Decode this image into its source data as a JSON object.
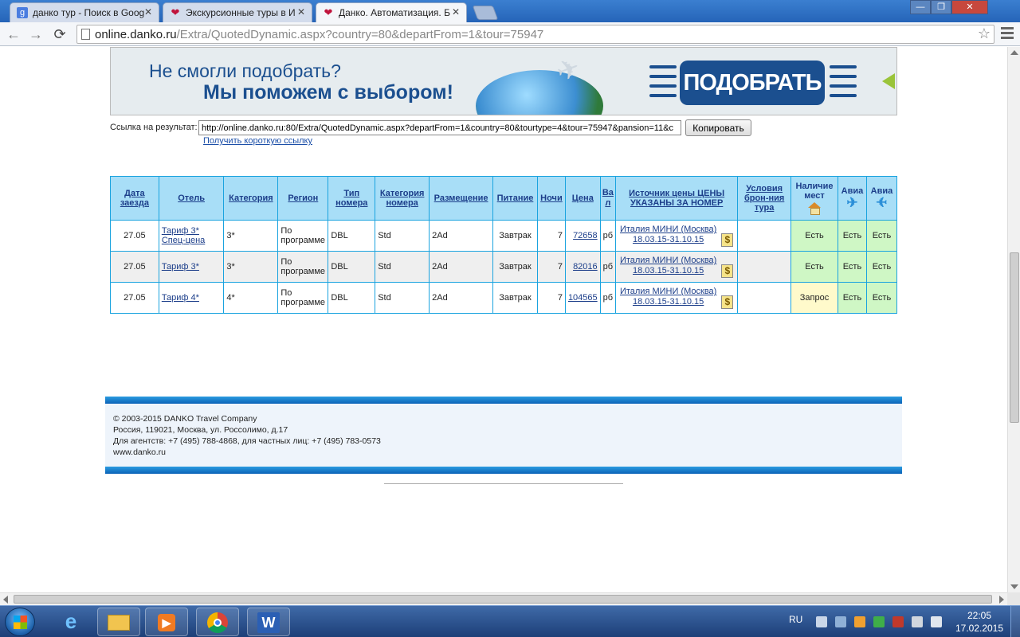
{
  "browser": {
    "tabs": [
      {
        "title": "данко тур - Поиск в Goog",
        "icon": "google-icon",
        "active": false
      },
      {
        "title": "Экскурсионные туры в И",
        "icon": "danko-heart-icon",
        "active": false
      },
      {
        "title": "Данко. Автоматизация. Б",
        "icon": "danko-heart-icon",
        "active": true
      }
    ],
    "url": {
      "host": "online.danko.ru",
      "path": "/Extra/QuotedDynamic.aspx?country=80&departFrom=1&tour=75947"
    }
  },
  "banner": {
    "line1": "Не смогли подобрать?",
    "line2": "Мы поможем с выбором!",
    "button": "ПОДОБРАТЬ"
  },
  "result_link": {
    "label": "Ссылка на результат:",
    "value": "http://online.danko.ru:80/Extra/QuotedDynamic.aspx?departFrom=1&country=80&tourtype=4&tour=75947&pansion=11&c",
    "copy_button": "Копировать",
    "short_link": "Получить короткую ссылку"
  },
  "table": {
    "headers": {
      "date": "Дата заезда",
      "hotel": "Отель",
      "category": "Категория",
      "region": "Регион",
      "room_type": "Тип номера",
      "room_category": "Категория номера",
      "accommodation": "Размещение",
      "meals": "Питание",
      "nights": "Ночи",
      "price": "Цена",
      "currency": "Вал",
      "source": "Источник цены ЦЕНЫ УКАЗАНЫ ЗА НОМЕР",
      "conditions": "Условия брон-ния тура",
      "availability": "Наличие мест",
      "avia1": "Авиа",
      "avia2": "Авиа"
    },
    "rows": [
      {
        "date": "27.05",
        "hotel": "Тариф 3* Спец-цена",
        "category": "3*",
        "region": "По программе",
        "room_type": "DBL",
        "room_category": "Std",
        "accommodation": "2Ad",
        "meals": "Завтрак",
        "nights": "7",
        "price": "72658",
        "currency": "рб",
        "source_name": "Италия МИНИ (Москва)",
        "source_dates": "18.03.15-31.10.15",
        "conditions": "",
        "availability": "Есть",
        "avia1": "Есть",
        "avia2": "Есть"
      },
      {
        "date": "27.05",
        "hotel": "Тариф 3*",
        "category": "3*",
        "region": "По программе",
        "room_type": "DBL",
        "room_category": "Std",
        "accommodation": "2Ad",
        "meals": "Завтрак",
        "nights": "7",
        "price": "82016",
        "currency": "рб",
        "source_name": "Италия МИНИ (Москва)",
        "source_dates": "18.03.15-31.10.15",
        "conditions": "",
        "availability": "Есть",
        "avia1": "Есть",
        "avia2": "Есть"
      },
      {
        "date": "27.05",
        "hotel": "Тариф 4*",
        "category": "4*",
        "region": "По программе",
        "room_type": "DBL",
        "room_category": "Std",
        "accommodation": "2Ad",
        "meals": "Завтрак",
        "nights": "7",
        "price": "104565",
        "currency": "рб",
        "source_name": "Италия МИНИ (Москва)",
        "source_dates": "18.03.15-31.10.15",
        "conditions": "",
        "availability": "Запрос",
        "avia1": "Есть",
        "avia2": "Есть"
      }
    ]
  },
  "footer": {
    "copyright": "© 2003-2015 DANKO Travel Company",
    "address": "Россия, 119021, Москва, ул. Россолимо, д.17",
    "phones": "Для агентств: +7 (495) 788-4868, для частных лиц: +7 (495) 783-0573",
    "site": "www.danko.ru"
  },
  "taskbar": {
    "apps": [
      "ie-icon",
      "explorer-icon",
      "media-player-icon",
      "chrome-icon",
      "word-icon"
    ],
    "word_label": "W",
    "lang": "RU",
    "time": "22:05",
    "date": "17.02.2015"
  },
  "colors": {
    "header_bg": "#a8def7",
    "border": "#1aa3df",
    "available": "#cff7c5",
    "request": "#fffacb",
    "brand_blue": "#1b4f8f"
  }
}
